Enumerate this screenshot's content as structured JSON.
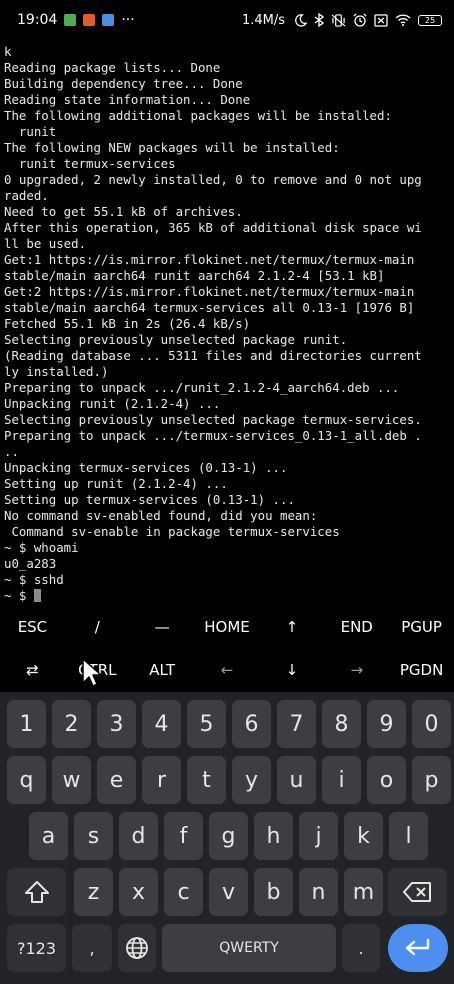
{
  "status_bar": {
    "time": "19:04",
    "more": "···",
    "net_speed": "1.4M/s",
    "battery": "25",
    "colors": {
      "app1": "#4caf50",
      "app2": "#e35d2c",
      "app3": "#4a8fe0"
    }
  },
  "terminal": {
    "lines": [
      "k",
      "Reading package lists... Done",
      "Building dependency tree... Done",
      "Reading state information... Done",
      "The following additional packages will be installed:",
      "  runit",
      "The following NEW packages will be installed:",
      "  runit termux-services",
      "0 upgraded, 2 newly installed, 0 to remove and 0 not upg",
      "raded.",
      "Need to get 55.1 kB of archives.",
      "After this operation, 365 kB of additional disk space wi",
      "ll be used.",
      "Get:1 https://is.mirror.flokinet.net/termux/termux-main",
      "stable/main aarch64 runit aarch64 2.1.2-4 [53.1 kB]",
      "Get:2 https://is.mirror.flokinet.net/termux/termux-main",
      "stable/main aarch64 termux-services all 0.13-1 [1976 B]",
      "Fetched 55.1 kB in 2s (26.4 kB/s)",
      "Selecting previously unselected package runit.",
      "(Reading database ... 5311 files and directories current",
      "ly installed.)",
      "Preparing to unpack .../runit_2.1.2-4_aarch64.deb ...",
      "Unpacking runit (2.1.2-4) ...",
      "Selecting previously unselected package termux-services.",
      "Preparing to unpack .../termux-services_0.13-1_all.deb .",
      "..",
      "Unpacking termux-services (0.13-1) ...",
      "Setting up runit (2.1.2-4) ...",
      "Setting up termux-services (0.13-1) ...",
      "No command sv-enabled found, did you mean:",
      " Command sv-enable in package termux-services",
      "~ $ whoami",
      "u0_a283",
      "~ $ sshd"
    ],
    "prompt": "~ $ "
  },
  "extra_keys": {
    "row1": [
      "ESC",
      "/",
      "—",
      "HOME",
      "↑",
      "END",
      "PGUP"
    ],
    "row2": [
      "⇄",
      "CTRL",
      "ALT",
      "←",
      "↓",
      "→",
      "PGDN"
    ]
  },
  "keyboard": {
    "numbers": [
      "1",
      "2",
      "3",
      "4",
      "5",
      "6",
      "7",
      "8",
      "9",
      "0"
    ],
    "row_q": [
      "q",
      "w",
      "e",
      "r",
      "t",
      "y",
      "u",
      "i",
      "o",
      "p"
    ],
    "row_a": [
      "a",
      "s",
      "d",
      "f",
      "g",
      "h",
      "j",
      "k",
      "l"
    ],
    "row_z": [
      "z",
      "x",
      "c",
      "v",
      "b",
      "n",
      "m"
    ],
    "symbols_label": "?123",
    "comma": ",",
    "space_label": "QWERTY",
    "period": ".",
    "accent": "#4c8ff0"
  }
}
